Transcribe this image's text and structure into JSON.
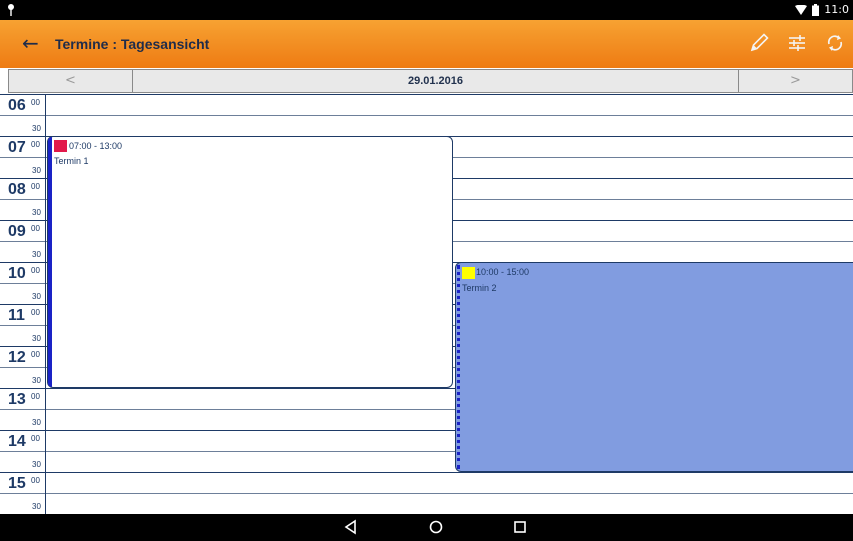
{
  "status": {
    "time": "11:0"
  },
  "toolbar": {
    "back_icon": "arrow-left-icon",
    "title": "Termine : Tagesansicht",
    "actions": [
      "pencil-icon",
      "tune-sliders-icon",
      "sync-icon"
    ]
  },
  "date_nav": {
    "prev_label": "<",
    "date": "29.01.2016",
    "next_label": ">"
  },
  "time_slots": [
    {
      "hour": "06",
      "minute": "00"
    },
    {
      "hour": "",
      "minute": "30"
    },
    {
      "hour": "07",
      "minute": "00"
    },
    {
      "hour": "",
      "minute": "30"
    },
    {
      "hour": "08",
      "minute": "00"
    },
    {
      "hour": "",
      "minute": "30"
    },
    {
      "hour": "09",
      "minute": "00"
    },
    {
      "hour": "",
      "minute": "30"
    },
    {
      "hour": "10",
      "minute": "00"
    },
    {
      "hour": "",
      "minute": "30"
    },
    {
      "hour": "11",
      "minute": "00"
    },
    {
      "hour": "",
      "minute": "30"
    },
    {
      "hour": "12",
      "minute": "00"
    },
    {
      "hour": "",
      "minute": "30"
    },
    {
      "hour": "13",
      "minute": "00"
    },
    {
      "hour": "",
      "minute": "30"
    },
    {
      "hour": "14",
      "minute": "00"
    },
    {
      "hour": "",
      "minute": "30"
    },
    {
      "hour": "15",
      "minute": "00"
    },
    {
      "hour": "",
      "minute": "30"
    }
  ],
  "events": [
    {
      "time": "07:00 - 13:00",
      "title": "Termin 1",
      "color": "#e2194b"
    },
    {
      "time": "10:00 - 15:00",
      "title": "Termin 2",
      "color": "#ffff00"
    }
  ],
  "navbar": {
    "icons": [
      "back-triangle-icon",
      "home-circle-icon",
      "recents-square-icon"
    ]
  }
}
